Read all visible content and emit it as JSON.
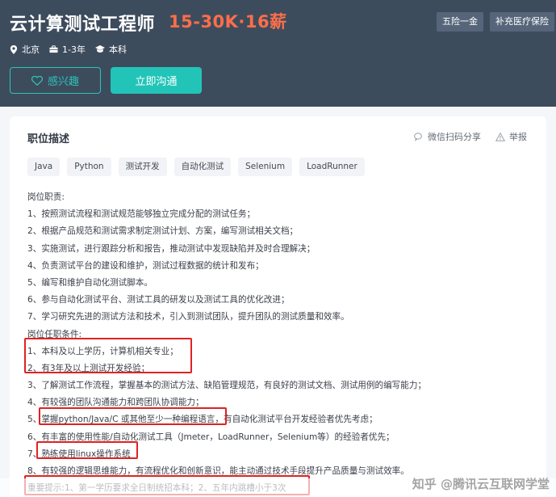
{
  "job": {
    "title": "云计算测试工程师",
    "salary": "15-30K·16薪",
    "benefits": [
      "五险一金",
      "补充医疗保险"
    ],
    "location": "北京",
    "experience": "1-3年",
    "education": "本科"
  },
  "actions": {
    "like_label": "感兴趣",
    "chat_label": "立即沟通"
  },
  "card": {
    "section_title": "职位描述",
    "share_label": "微信扫码分享",
    "report_label": "举报",
    "tags": [
      "Java",
      "Python",
      "测试开发",
      "自动化测试",
      "Selenium",
      "LoadRunner"
    ]
  },
  "description": [
    "岗位职责:",
    "1、按照测试流程和测试规范能够独立完成分配的测试任务；",
    "2、根据产品规范和测试需求制定测试计划、方案，编写测试相关文档；",
    "3、实施测试，进行跟踪分析和报告，推动测试中发现缺陷并及时合理解决；",
    "4、负责测试平台的建设和维护，测试过程数据的统计和发布；",
    "5、编写和维护自动化测试脚本。",
    "6、参与自动化测试平台、测试工具的研发以及测试工具的优化改进；",
    "7、学习研究先进的测试方法和技术，引入到测试团队，提升团队的测试质量和效率。",
    "岗位任职条件:",
    "1、本科及以上学历，计算机相关专业；",
    "2、有3年及以上测试开发经验；",
    "3、了解测试工作流程，掌握基本的测试方法、缺陷管理规范，有良好的测试文档、测试用例的编写能力；",
    "4、有较强的团队沟通能力和跨团队协调能力；",
    "5、掌握python/Java/C 或其他至少一种编程语言，有自动化测试平台开发经验者优先考虑；",
    "6、有丰富的使用性能/自动化测试工具（Jmeter，LoadRunner，Selenium等）的经验者优先；",
    "7、熟练使用linux操作系统",
    "8、有较强的逻辑思维能力，有流程优化和创新意识，能主动通过技术手段提升产品质量与测试效率。",
    "重要提示:1、第一学历要求全日制统招本科；2、五年内跳槽小于3次"
  ],
  "watermark": "知乎 @腾讯云互联网学堂",
  "colors": {
    "header_bg": "#3d4c5d",
    "salary": "#fd6e4a",
    "accent": "#22c4b8",
    "highlight_box": "#e02222"
  },
  "icons": [
    "location-icon",
    "briefcase-icon",
    "graduation-cap-icon",
    "heart-icon",
    "wechat-icon",
    "warning-icon"
  ]
}
